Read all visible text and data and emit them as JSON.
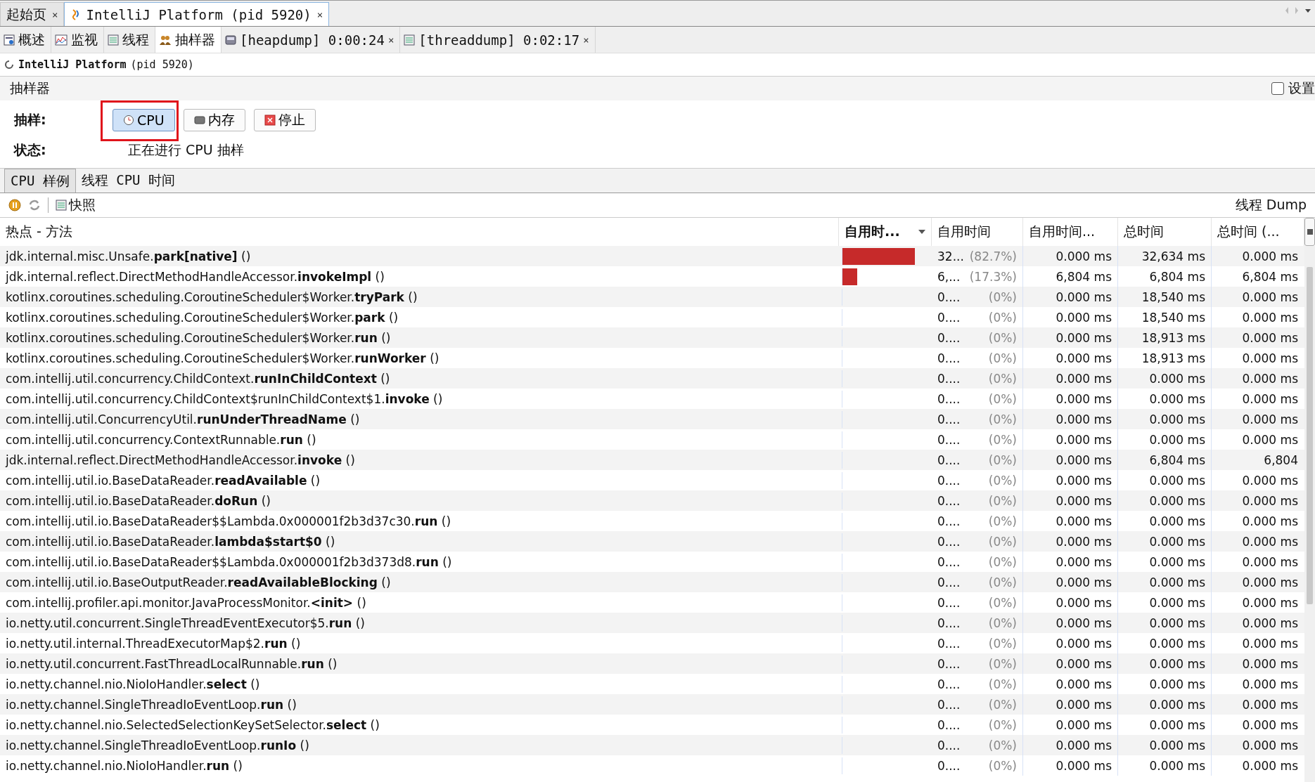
{
  "document_tabs": [
    {
      "label": "起始页",
      "selected": false,
      "close": "×"
    },
    {
      "label": "IntelliJ Platform (pid 5920)",
      "selected": true,
      "close": "×"
    }
  ],
  "view_tabs": [
    {
      "label": "概述",
      "selected": false
    },
    {
      "label": "监视",
      "selected": false
    },
    {
      "label": "线程",
      "selected": false
    },
    {
      "label": "抽样器",
      "selected": true
    },
    {
      "label": "[heapdump] 0:00:24",
      "selected": false,
      "close": "×"
    },
    {
      "label": "[threaddump] 0:02:17",
      "selected": false,
      "close": "×"
    }
  ],
  "app": {
    "name": "IntelliJ Platform",
    "pid": "(pid 5920)"
  },
  "section": {
    "title": "抽样器",
    "settings": {
      "label": "设置",
      "checked": false
    }
  },
  "sampling": {
    "label": "抽样:",
    "buttons": [
      {
        "label": "CPU",
        "selected": true,
        "highlighted": true
      },
      {
        "label": "内存",
        "selected": false,
        "highlighted": false
      },
      {
        "label": "停止",
        "selected": false,
        "highlighted": false
      }
    ],
    "status_label": "状态:",
    "status": "正在进行 CPU 抽样"
  },
  "result_tabs": [
    {
      "label": "CPU 样例",
      "selected": true
    },
    {
      "label": "线程 CPU 时间",
      "selected": false
    }
  ],
  "toolbar": {
    "snapshot": "快照",
    "thread_dump": "线程 Dump"
  },
  "table": {
    "columns": [
      {
        "label": "热点 - 方法",
        "sorted": false
      },
      {
        "label": "自用时...",
        "sorted": true
      },
      {
        "label": "自用时间",
        "sorted": false
      },
      {
        "label": "自用时间...",
        "sorted": false
      },
      {
        "label": "总时间",
        "sorted": false
      },
      {
        "label": "总时间 (...",
        "sorted": false
      }
    ],
    "rows": [
      {
        "method": "jdk.internal.misc.Unsafe.**park[native]** ()",
        "level": 0.827,
        "self": "32...",
        "percent": "(82.7%)",
        "self_cpu": "0.000 ms",
        "total": "32,634 ms",
        "total_cpu": "0.000 ms"
      },
      {
        "method": "jdk.internal.reflect.DirectMethodHandleAccessor.**invokeImpl** ()",
        "level": 0.173,
        "self": "6,...",
        "percent": "(17.3%)",
        "self_cpu": "6,804 ms",
        "total": "6,804 ms",
        "total_cpu": "6,804 ms"
      },
      {
        "method": "kotlinx.coroutines.scheduling.CoroutineScheduler$Worker.**tryPark** ()",
        "level": 0,
        "self": "0....",
        "percent": "(0%)",
        "self_cpu": "0.000 ms",
        "total": "18,540 ms",
        "total_cpu": "0.000 ms"
      },
      {
        "method": "kotlinx.coroutines.scheduling.CoroutineScheduler$Worker.**park** ()",
        "level": 0,
        "self": "0....",
        "percent": "(0%)",
        "self_cpu": "0.000 ms",
        "total": "18,540 ms",
        "total_cpu": "0.000 ms"
      },
      {
        "method": "kotlinx.coroutines.scheduling.CoroutineScheduler$Worker.**run** ()",
        "level": 0,
        "self": "0....",
        "percent": "(0%)",
        "self_cpu": "0.000 ms",
        "total": "18,913 ms",
        "total_cpu": "0.000 ms"
      },
      {
        "method": "kotlinx.coroutines.scheduling.CoroutineScheduler$Worker.**runWorker** ()",
        "level": 0,
        "self": "0....",
        "percent": "(0%)",
        "self_cpu": "0.000 ms",
        "total": "18,913 ms",
        "total_cpu": "0.000 ms"
      },
      {
        "method": "com.intellij.util.concurrency.ChildContext.**runInChildContext** ()",
        "level": 0,
        "self": "0....",
        "percent": "(0%)",
        "self_cpu": "0.000 ms",
        "total": "0.000 ms",
        "total_cpu": "0.000 ms"
      },
      {
        "method": "com.intellij.util.concurrency.ChildContext$runInChildContext$1.**invoke** ()",
        "level": 0,
        "self": "0....",
        "percent": "(0%)",
        "self_cpu": "0.000 ms",
        "total": "0.000 ms",
        "total_cpu": "0.000 ms"
      },
      {
        "method": "com.intellij.util.ConcurrencyUtil.**runUnderThreadName** ()",
        "level": 0,
        "self": "0....",
        "percent": "(0%)",
        "self_cpu": "0.000 ms",
        "total": "0.000 ms",
        "total_cpu": "0.000 ms"
      },
      {
        "method": "com.intellij.util.concurrency.ContextRunnable.**run** ()",
        "level": 0,
        "self": "0....",
        "percent": "(0%)",
        "self_cpu": "0.000 ms",
        "total": "0.000 ms",
        "total_cpu": "0.000 ms"
      },
      {
        "method": "jdk.internal.reflect.DirectMethodHandleAccessor.**invoke** ()",
        "level": 0,
        "self": "0....",
        "percent": "(0%)",
        "self_cpu": "0.000 ms",
        "total": "6,804 ms",
        "total_cpu": "6,804"
      },
      {
        "method": "com.intellij.util.io.BaseDataReader.**readAvailable** ()",
        "level": 0,
        "self": "0....",
        "percent": "(0%)",
        "self_cpu": "0.000 ms",
        "total": "0.000 ms",
        "total_cpu": "0.000 ms"
      },
      {
        "method": "com.intellij.util.io.BaseDataReader.**doRun** ()",
        "level": 0,
        "self": "0....",
        "percent": "(0%)",
        "self_cpu": "0.000 ms",
        "total": "0.000 ms",
        "total_cpu": "0.000 ms"
      },
      {
        "method": "com.intellij.util.io.BaseDataReader$$Lambda.0x000001f2b3d37c30.**run** ()",
        "level": 0,
        "self": "0....",
        "percent": "(0%)",
        "self_cpu": "0.000 ms",
        "total": "0.000 ms",
        "total_cpu": "0.000 ms"
      },
      {
        "method": "com.intellij.util.io.BaseDataReader.**lambda$start$0** ()",
        "level": 0,
        "self": "0....",
        "percent": "(0%)",
        "self_cpu": "0.000 ms",
        "total": "0.000 ms",
        "total_cpu": "0.000 ms"
      },
      {
        "method": "com.intellij.util.io.BaseDataReader$$Lambda.0x000001f2b3d373d8.**run** ()",
        "level": 0,
        "self": "0....",
        "percent": "(0%)",
        "self_cpu": "0.000 ms",
        "total": "0.000 ms",
        "total_cpu": "0.000 ms"
      },
      {
        "method": "com.intellij.util.io.BaseOutputReader.**readAvailableBlocking** ()",
        "level": 0,
        "self": "0....",
        "percent": "(0%)",
        "self_cpu": "0.000 ms",
        "total": "0.000 ms",
        "total_cpu": "0.000 ms"
      },
      {
        "method": "com.intellij.profiler.api.monitor.JavaProcessMonitor.**<init>** ()",
        "level": 0,
        "self": "0....",
        "percent": "(0%)",
        "self_cpu": "0.000 ms",
        "total": "0.000 ms",
        "total_cpu": "0.000 ms"
      },
      {
        "method": "io.netty.util.concurrent.SingleThreadEventExecutor$5.**run** ()",
        "level": 0,
        "self": "0....",
        "percent": "(0%)",
        "self_cpu": "0.000 ms",
        "total": "0.000 ms",
        "total_cpu": "0.000 ms"
      },
      {
        "method": "io.netty.util.internal.ThreadExecutorMap$2.**run** ()",
        "level": 0,
        "self": "0....",
        "percent": "(0%)",
        "self_cpu": "0.000 ms",
        "total": "0.000 ms",
        "total_cpu": "0.000 ms"
      },
      {
        "method": "io.netty.util.concurrent.FastThreadLocalRunnable.**run** ()",
        "level": 0,
        "self": "0....",
        "percent": "(0%)",
        "self_cpu": "0.000 ms",
        "total": "0.000 ms",
        "total_cpu": "0.000 ms"
      },
      {
        "method": "io.netty.channel.nio.NioIoHandler.**select** ()",
        "level": 0,
        "self": "0....",
        "percent": "(0%)",
        "self_cpu": "0.000 ms",
        "total": "0.000 ms",
        "total_cpu": "0.000 ms"
      },
      {
        "method": "io.netty.channel.SingleThreadIoEventLoop.**run** ()",
        "level": 0,
        "self": "0....",
        "percent": "(0%)",
        "self_cpu": "0.000 ms",
        "total": "0.000 ms",
        "total_cpu": "0.000 ms"
      },
      {
        "method": "io.netty.channel.nio.SelectedSelectionKeySetSelector.**select** ()",
        "level": 0,
        "self": "0....",
        "percent": "(0%)",
        "self_cpu": "0.000 ms",
        "total": "0.000 ms",
        "total_cpu": "0.000 ms"
      },
      {
        "method": "io.netty.channel.SingleThreadIoEventLoop.**runIo** ()",
        "level": 0,
        "self": "0....",
        "percent": "(0%)",
        "self_cpu": "0.000 ms",
        "total": "0.000 ms",
        "total_cpu": "0.000 ms"
      },
      {
        "method": "io.netty.channel.nio.NioIoHandler.**run** ()",
        "level": 0,
        "self": "0....",
        "percent": "(0%)",
        "self_cpu": "0.000 ms",
        "total": "0.000 ms",
        "total_cpu": "0.000 ms"
      }
    ]
  }
}
